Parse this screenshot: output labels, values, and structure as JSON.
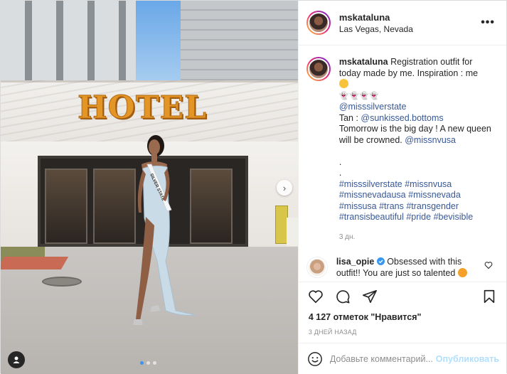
{
  "post": {
    "author": {
      "username": "mskataluna",
      "location": "Las Vegas, Nevada",
      "avatar_icon": "profile-photo"
    },
    "more_icon": "more-horizontal-icon",
    "more_label": "•••",
    "photo": {
      "sign_text": "HOTEL",
      "sash_text": "SILVER STATE",
      "next_icon": "chevron-right-icon",
      "next_label": "›",
      "carousel_count": 3,
      "carousel_active_index": 0,
      "user_tag_icon": "user-icon"
    },
    "caption": {
      "username": "mskataluna",
      "text_1": "Registration outfit for today made by me. Inspiration : me",
      "emoji_1": "grinning-face-with-tongue-emoji",
      "ghost_line": "👻👻👻👻",
      "mention_1": "@misssilverstate",
      "tan_prefix": "Tan : ",
      "mention_2": "@sunkissed.bottoms",
      "text_2": "Tomorrow is the big day ! A new queen will be crowned. ",
      "mention_3": "@missnvusa",
      "dot_1": ".",
      "dot_2": ".",
      "hashtags": [
        "#misssilverstate",
        "#missnvusa",
        "#missnevadausa",
        "#missnevada",
        "#missusa",
        "#trans",
        "#transgender",
        "#transisbeautiful",
        "#pride",
        "#bevisible"
      ],
      "time_ago": "3 дн."
    },
    "comment": {
      "username": "lisa_opie",
      "verified_icon": "verified-badge-icon",
      "text": "Obsessed with this outfit!! You are just so talented",
      "emoji": "star-struck-emoji",
      "like_icon": "heart-outline-icon"
    },
    "actions": {
      "like_icon": "heart-icon",
      "comment_icon": "comment-icon",
      "share_icon": "paper-plane-icon",
      "save_icon": "bookmark-icon"
    },
    "likes_text": "4 127 отметок \"Нравится\"",
    "date_text": "3 ДНЕЙ НАЗАД",
    "add_comment": {
      "emoji_icon": "smiley-icon",
      "placeholder": "Добавьте комментарий...",
      "post_label": "Опубликовать"
    }
  }
}
